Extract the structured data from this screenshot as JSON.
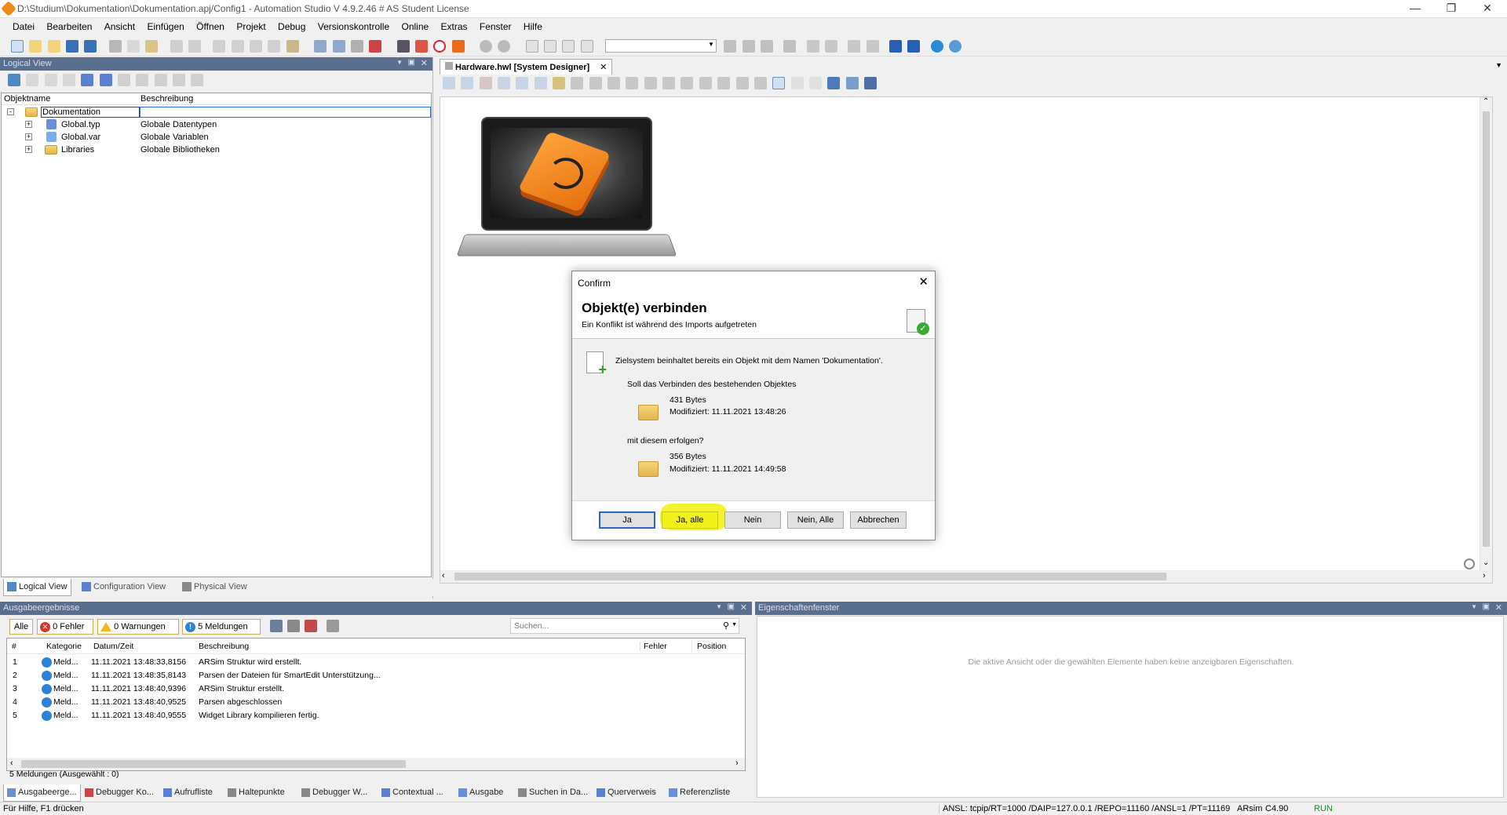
{
  "window": {
    "title": "D:\\Studium\\Dokumentation\\Dokumentation.apj/Config1 - Automation Studio V 4.9.2.46 # AS Student License"
  },
  "menu": [
    "Datei",
    "Bearbeiten",
    "Ansicht",
    "Einfügen",
    "Öffnen",
    "Projekt",
    "Debug",
    "Versionskontrolle",
    "Online",
    "Extras",
    "Fenster",
    "Hilfe"
  ],
  "logical_view": {
    "header": "Logical View",
    "columns": [
      "Objektname",
      "Beschreibung"
    ],
    "rows": [
      {
        "name": "Dokumentation",
        "desc": ""
      },
      {
        "name": "Global.typ",
        "desc": "Globale Datentypen"
      },
      {
        "name": "Global.var",
        "desc": "Globale Variablen"
      },
      {
        "name": "Libraries",
        "desc": "Globale Bibliotheken"
      }
    ],
    "tabs": [
      "Logical View",
      "Configuration View",
      "Physical View"
    ]
  },
  "designer": {
    "tab_label": "Hardware.hwl [System Designer]"
  },
  "dialog": {
    "window_title": "Confirm",
    "heading": "Objekt(e) verbinden",
    "subheading": "Ein Konflikt ist während des Imports aufgetreten",
    "message": "Zielsystem beinhaltet bereits ein Objekt mit dem Namen 'Dokumentation'.",
    "question": "Soll das Verbinden des bestehenden Objektes",
    "existing": {
      "size": "431 Bytes",
      "modified": "Modifiziert: 11.11.2021 13:48:26"
    },
    "with_label": "mit diesem erfolgen?",
    "incoming": {
      "size": "356 Bytes",
      "modified": "Modifiziert: 11.11.2021 14:49:58"
    },
    "buttons": [
      "Ja",
      "Ja, alle",
      "Nein",
      "Nein, Alle",
      "Abbrechen"
    ],
    "highlight_color": "#f2f21a"
  },
  "output": {
    "header": "Ausgabeergebnisse",
    "filters": {
      "all": "Alle",
      "errors": "0 Fehler",
      "warnings": "0 Warnungen",
      "messages": "5 Meldungen"
    },
    "search_placeholder": "Suchen...",
    "columns": [
      "#",
      "Kategorie",
      "Datum/Zeit",
      "Beschreibung",
      "Fehler",
      "Position"
    ],
    "rows": [
      {
        "n": "1",
        "cat": "Meld...",
        "time": "11.11.2021 13:48:33,8156",
        "desc": "ARSim Struktur wird erstellt."
      },
      {
        "n": "2",
        "cat": "Meld...",
        "time": "11.11.2021 13:48:35,8143",
        "desc": "Parsen der Dateien für SmartEdit Unterstützung..."
      },
      {
        "n": "3",
        "cat": "Meld...",
        "time": "11.11.2021 13:48:40,9396",
        "desc": "ARSim Struktur erstellt."
      },
      {
        "n": "4",
        "cat": "Meld...",
        "time": "11.11.2021 13:48:40,9525",
        "desc": "Parsen abgeschlossen"
      },
      {
        "n": "5",
        "cat": "Meld...",
        "time": "11.11.2021 13:48:40,9555",
        "desc": "Widget Library kompilieren fertig."
      }
    ],
    "footer": "5 Meldungen (Ausgewählt : 0)"
  },
  "properties": {
    "header": "Eigenschaftenfenster",
    "empty_text": "Die aktive Ansicht oder die gewählten Elemente haben keine anzeigbaren Eigenschaften."
  },
  "bottom_tabs": [
    "Ausgabeerge...",
    "Debugger Ko...",
    "Aufrufliste",
    "Haltepunkte",
    "Debugger W...",
    "Contextual ...",
    "Ausgabe",
    "Suchen in Da...",
    "Querverweis",
    "Referenzliste"
  ],
  "status": {
    "hint": "Für Hilfe, F1 drücken",
    "connection": "ANSL: tcpip/RT=1000 /DAIP=127.0.0.1 /REPO=11160 /ANSL=1 /PT=11169",
    "target": "ARsim",
    "version": "C4.90",
    "mode": "RUN"
  }
}
